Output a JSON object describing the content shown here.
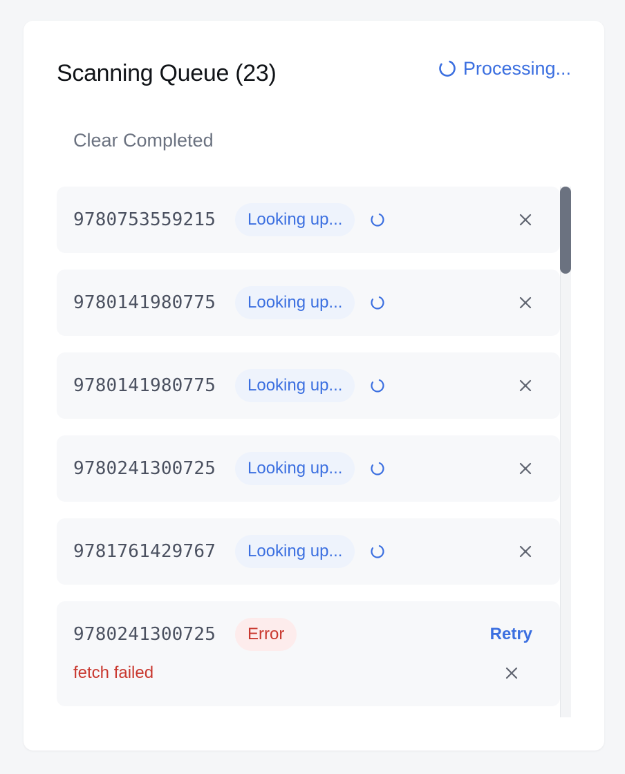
{
  "header": {
    "title": "Scanning Queue (23)",
    "status_text": "Processing...",
    "status_icon": "loading-spinner-icon"
  },
  "actions": {
    "clear_label": "Clear Completed"
  },
  "queue": {
    "items": [
      {
        "isbn": "9780753559215",
        "status": "Looking up...",
        "state": "loading"
      },
      {
        "isbn": "9780141980775",
        "status": "Looking up...",
        "state": "loading"
      },
      {
        "isbn": "9780141980775",
        "status": "Looking up...",
        "state": "loading"
      },
      {
        "isbn": "9780241300725",
        "status": "Looking up...",
        "state": "loading"
      },
      {
        "isbn": "9781761429767",
        "status": "Looking up...",
        "state": "loading"
      },
      {
        "isbn": "9780241300725",
        "status": "Error",
        "state": "error",
        "error_message": "fetch failed",
        "retry_label": "Retry"
      }
    ]
  },
  "colors": {
    "accent": "#3b6fe0",
    "error": "#c9382f",
    "item_bg": "#f7f8fa",
    "lookup_badge_bg": "#eef3fc",
    "error_badge_bg": "#fdecec",
    "muted_text": "#6b7280"
  }
}
